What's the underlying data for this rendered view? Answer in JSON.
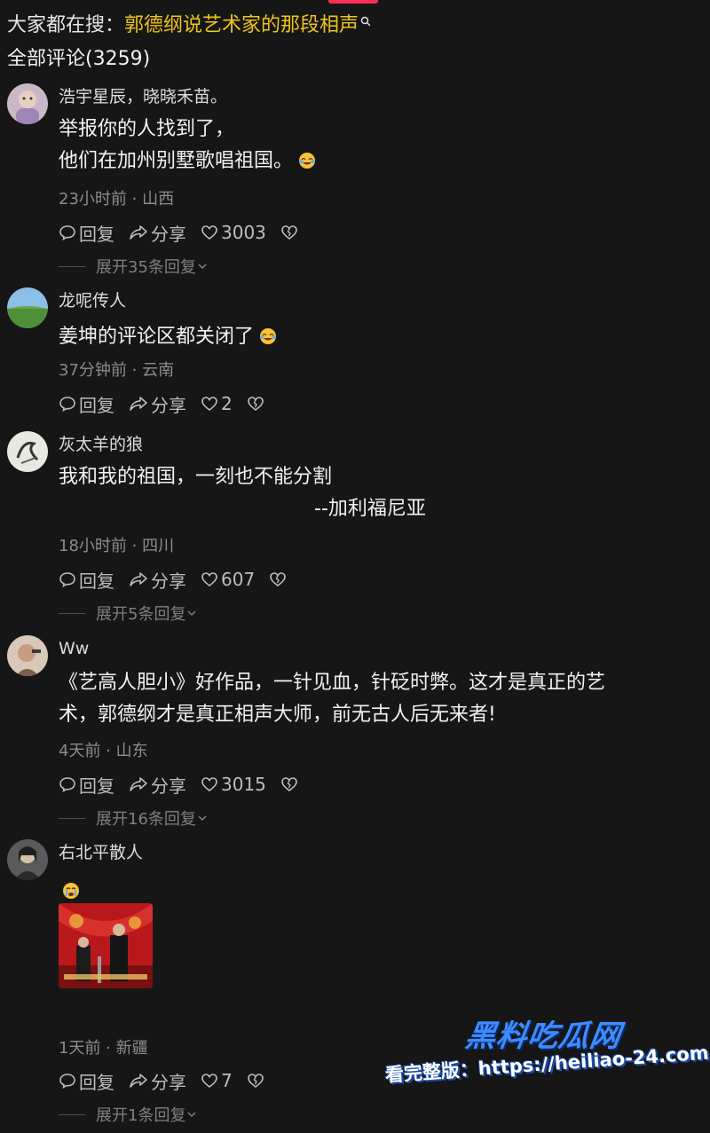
{
  "search": {
    "prefix": "大家都在搜：",
    "query": "郭德纲说艺术家的那段相声"
  },
  "comments_header": "全部评论(3259)",
  "actions": {
    "reply": "回复",
    "share": "分享"
  },
  "comments": [
    {
      "user": "浩宇星辰，晓晓禾苗。",
      "lines": [
        "举报你的人找到了，",
        "他们在加州别墅歌唱祖国。"
      ],
      "emoji": "laughing-crying-emoji",
      "meta": "23小时前 · 山西",
      "likes": "3003",
      "expand": "展开35条回复"
    },
    {
      "user": "龙呢传人",
      "lines": [
        "姜坤的评论区都关闭了"
      ],
      "emoji": "laughing-crying-emoji",
      "meta": "37分钟前 · 云南",
      "likes": "2",
      "expand": ""
    },
    {
      "user": "灰太羊的狼",
      "lines": [
        "我和我的祖国，一刻也不能分割",
        "--加利福尼亚"
      ],
      "meta": "18小时前 · 四川",
      "likes": "607",
      "expand": "展开5条回复"
    },
    {
      "user": "Ww",
      "lines": [
        "《艺高人胆小》好作品，一针见血，针砭时弊。这才是真正的艺",
        "术，郭德纲才是真正相声大师，前无古人后无来者!"
      ],
      "meta": "4天前 · 山东",
      "likes": "3015",
      "expand": "展开16条回复"
    },
    {
      "user": "右北平散人",
      "lines": [],
      "emoji": "crying-emoji",
      "meta": "1天前 · 新疆",
      "likes": "7",
      "expand": "展开1条回复"
    }
  ],
  "watermark": {
    "title": "黑料吃瓜网",
    "line": "看完整版：https://heiliao-24.com"
  }
}
